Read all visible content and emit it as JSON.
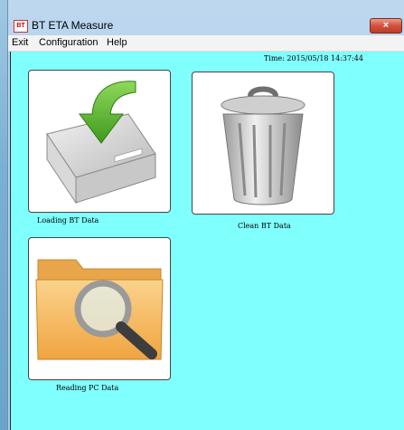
{
  "window": {
    "title": "BT ETA Measure",
    "icon_text": "BT",
    "close_glyph": "×"
  },
  "menu": {
    "items": [
      "Exit",
      "Configuration",
      "Help"
    ]
  },
  "status": {
    "time_text": "Time: 2015/05/18 14:37:44"
  },
  "tiles": [
    {
      "label": "Loading BT Data",
      "icon": "hard-drive-download-icon"
    },
    {
      "label": "Clean BT Data",
      "icon": "trash-can-icon"
    },
    {
      "label": "Reading PC Data",
      "icon": "folder-search-icon"
    }
  ],
  "colors": {
    "client_background": "#80ffff",
    "close_button": "#c9412b",
    "download_arrow": "#5ab32d",
    "folder": "#f4b150"
  }
}
